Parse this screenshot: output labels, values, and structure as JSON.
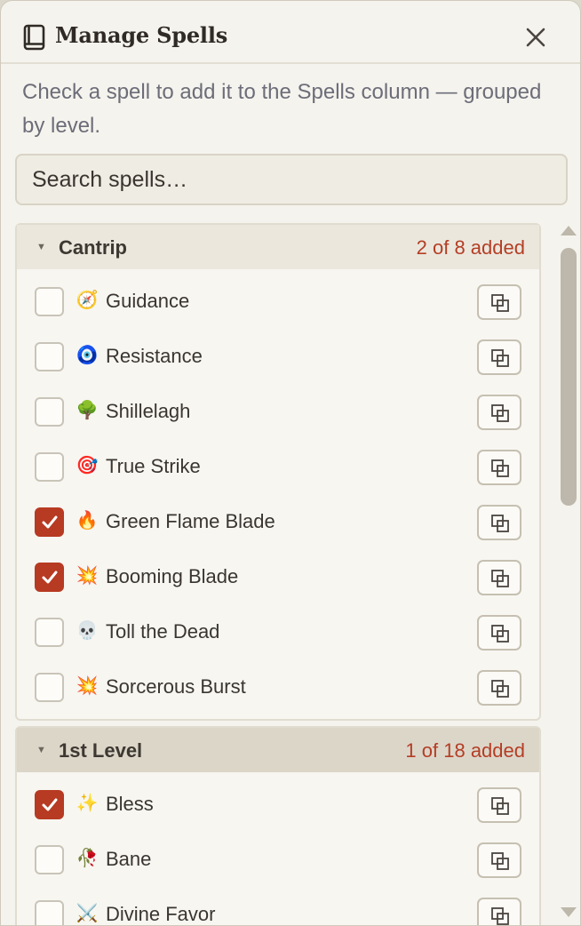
{
  "header": {
    "title": "Manage Spells",
    "book_icon": "book-icon",
    "close_icon": "close-icon"
  },
  "description": "Check a spell to add it to the Spells column — grouped by level.",
  "search": {
    "placeholder": "Search spells…",
    "value": ""
  },
  "colors": {
    "accent": "#b73a22",
    "count_text": "#b43e25",
    "panel_bg": "#f5f3ed"
  },
  "groups": [
    {
      "title": "Cantrip",
      "count": "2 of 8 added",
      "spells": [
        {
          "name": "Guidance",
          "emoji": "🧭",
          "checked": false
        },
        {
          "name": "Resistance",
          "emoji": "🧿",
          "checked": false
        },
        {
          "name": "Shillelagh",
          "emoji": "🌳",
          "checked": false
        },
        {
          "name": "True Strike",
          "emoji": "🎯",
          "checked": false
        },
        {
          "name": "Green Flame Blade",
          "emoji": "🔥",
          "checked": true
        },
        {
          "name": "Booming Blade",
          "emoji": "💥",
          "checked": true
        },
        {
          "name": "Toll the Dead",
          "emoji": "💀",
          "checked": false
        },
        {
          "name": "Sorcerous Burst",
          "emoji": "💥",
          "checked": false
        }
      ]
    },
    {
      "title": "1st Level",
      "count": "1 of 18 added",
      "spells": [
        {
          "name": "Bless",
          "emoji": "✨",
          "checked": true
        },
        {
          "name": "Bane",
          "emoji": "🥀",
          "checked": false
        },
        {
          "name": "Divine Favor",
          "emoji": "⚔️",
          "checked": false
        }
      ]
    }
  ]
}
